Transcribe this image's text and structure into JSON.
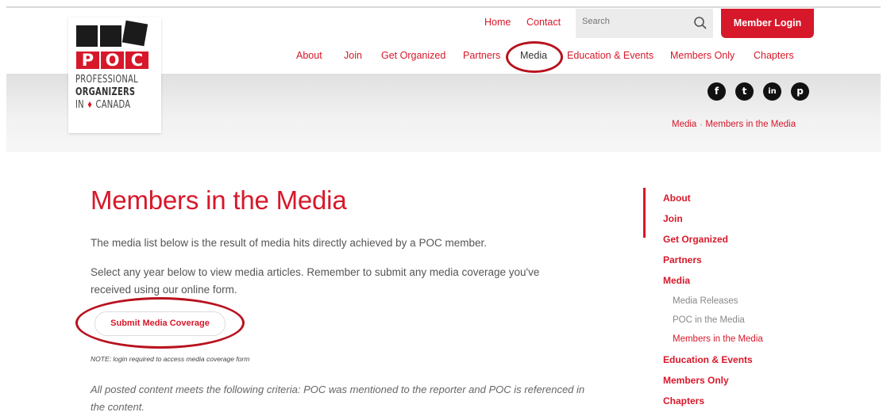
{
  "logo": {
    "letters": [
      "P",
      "O",
      "C"
    ],
    "line1": "PROFESSIONAL",
    "line2": "ORGANIZERS",
    "line3_a": "IN",
    "line3_b": "CANADA"
  },
  "utility_nav": {
    "home": "Home",
    "contact": "Contact",
    "search_placeholder": "Search",
    "login": "Member Login"
  },
  "main_nav": {
    "items": [
      "About",
      "Join",
      "Get Organized",
      "Partners",
      "Media",
      "Education & Events",
      "Members Only",
      "Chapters"
    ],
    "active": "Media"
  },
  "social": [
    "f",
    "t",
    "in",
    "p"
  ],
  "breadcrumb": {
    "parent": "Media",
    "current": "Members in the Media"
  },
  "content": {
    "title": "Members in the Media",
    "intro": "The media list below is the result of media hits directly achieved by a POC member.",
    "instructions_line1": "Select any year below to view media articles. Remember to submit any media coverage you've",
    "instructions_line2": "received using our online form.",
    "submit_button": "Submit Media Coverage",
    "note": "NOTE: login required to access media coverage form",
    "criteria_line1": "All posted content meets the following criteria: POC was mentioned to the reporter and POC is referenced in",
    "criteria_line2": "the content."
  },
  "sidebar": {
    "items": [
      "About",
      "Join",
      "Get Organized",
      "Partners",
      "Media"
    ],
    "media_subitems": [
      "Media Releases",
      "POC in the Media",
      "Members in the Media"
    ],
    "items_after": [
      "Education & Events",
      "Members Only",
      "Chapters"
    ]
  },
  "colors": {
    "brand_red": "#d7182a",
    "annotation_circle": "#b8121f"
  }
}
